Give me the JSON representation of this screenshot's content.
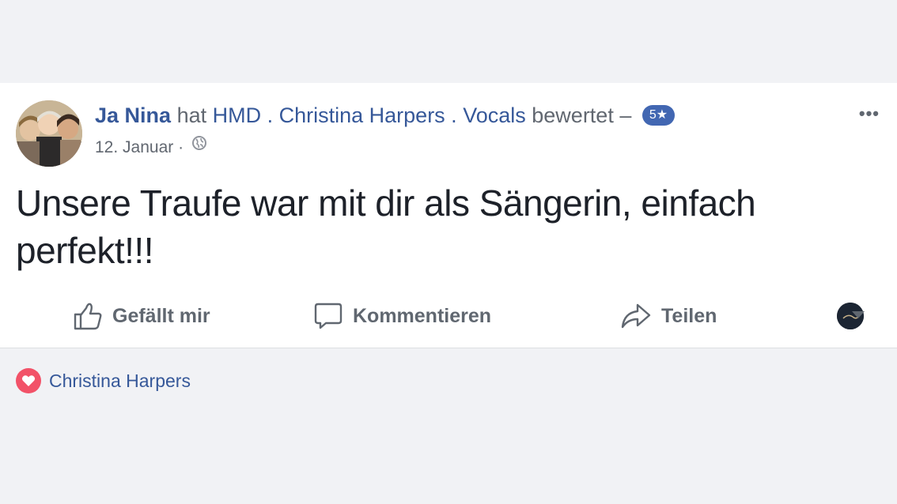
{
  "post": {
    "author": "Ja Nina",
    "verb": "hat",
    "page": "HMD . Christina Harpers . Vocals",
    "action": "bewertet –",
    "rating": "5★",
    "date": "12. Januar",
    "separator": "·",
    "privacy_icon": "globe-icon",
    "more_label": "•••",
    "text": "Unsere Traufe war mit dir als Sängerin, einfach perfekt!!!"
  },
  "actions": {
    "like": {
      "label": "Gefällt mir",
      "icon": "thumbs-up-icon"
    },
    "comment": {
      "label": "Kommentieren",
      "icon": "comment-icon"
    },
    "share": {
      "label": "Teilen",
      "icon": "share-icon"
    },
    "audience": {
      "icon": "avatar-dropdown"
    }
  },
  "reactions": {
    "icon": "heart-icon",
    "names": "Christina Harpers"
  },
  "colors": {
    "link": "#365899",
    "badge": "#4267b2",
    "heart": "#f25268",
    "background": "#f1f2f5"
  }
}
